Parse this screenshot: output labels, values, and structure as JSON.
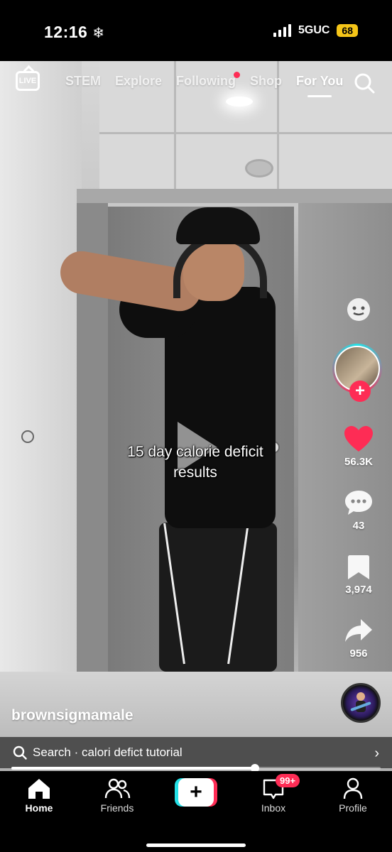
{
  "status_bar": {
    "time": "12:16",
    "time_icon": "snowflake-icon",
    "network": "5GUC",
    "battery": "68"
  },
  "top_nav": {
    "live_label": "LIVE",
    "tabs": [
      {
        "label": "STEM",
        "active": false
      },
      {
        "label": "Explore",
        "active": false
      },
      {
        "label": "Following",
        "active": false,
        "notification_dot": true
      },
      {
        "label": "Shop",
        "active": false
      },
      {
        "label": "For You",
        "active": true
      }
    ]
  },
  "video": {
    "caption_line1": "15 day calorie deficit",
    "caption_line2": "results",
    "progress": 0.66
  },
  "right_rail": {
    "likes": "56.3K",
    "comments": "43",
    "saves": "3,974",
    "shares": "956",
    "follow_label": "+"
  },
  "creator": {
    "username": "brownsigmamale"
  },
  "search_bar": {
    "text": "Search · calori defict tutorial"
  },
  "bottom_nav": {
    "items": [
      {
        "label": "Home",
        "active": true
      },
      {
        "label": "Friends",
        "active": false
      },
      {
        "label": "+",
        "active": false
      },
      {
        "label": "Inbox",
        "active": false,
        "badge": "99+"
      },
      {
        "label": "Profile",
        "active": false
      }
    ]
  },
  "colors": {
    "accent_red": "#fe2c55",
    "accent_cyan": "#24e0e6",
    "battery": "#f5c518"
  }
}
